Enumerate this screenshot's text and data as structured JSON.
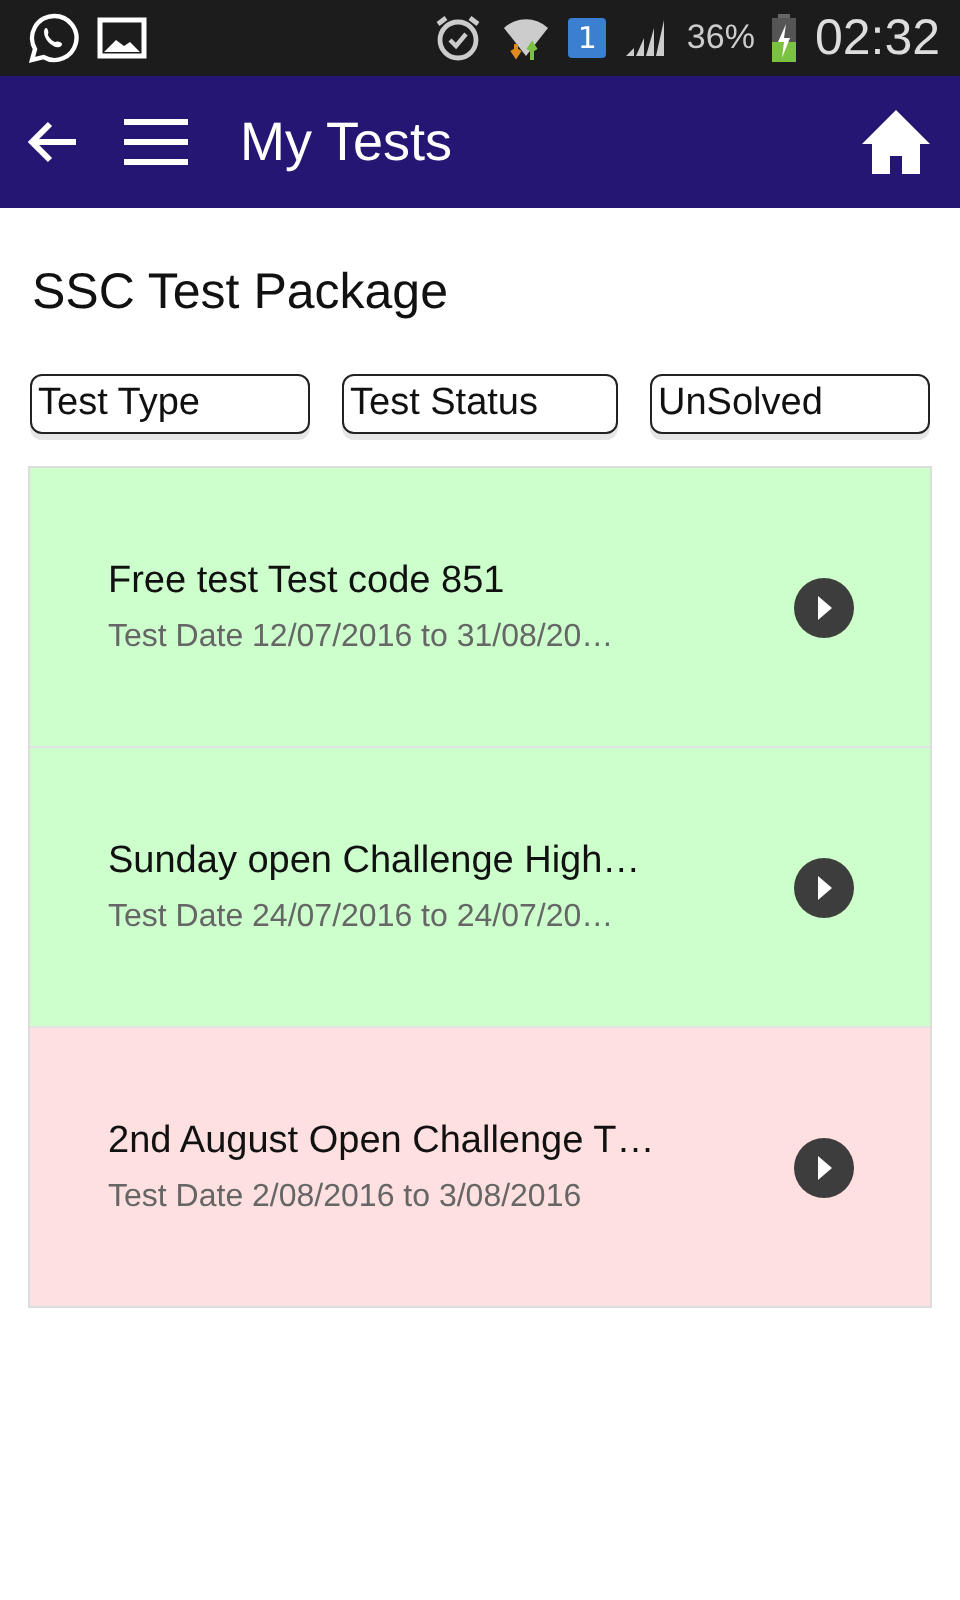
{
  "status_bar": {
    "sim_slot": "1",
    "battery": "36%",
    "time": "02:32"
  },
  "app_bar": {
    "title": "My Tests"
  },
  "package_title": "SSC Test Package",
  "filters": [
    {
      "label": "Test Type"
    },
    {
      "label": "Test Status"
    },
    {
      "label": "UnSolved"
    }
  ],
  "tests": [
    {
      "title": "Free test Test code 851",
      "dates": "Test Date 12/07/2016 to 31/08/20…",
      "color": "#ccffcc"
    },
    {
      "title": "Sunday open Challenge High…",
      "dates": "Test Date 24/07/2016 to 24/07/20…",
      "color": "#ccffcc"
    },
    {
      "title": "2nd August Open Challenge T…",
      "dates": "Test Date 2/08/2016 to 3/08/2016",
      "color": "#ffe0e0"
    }
  ]
}
